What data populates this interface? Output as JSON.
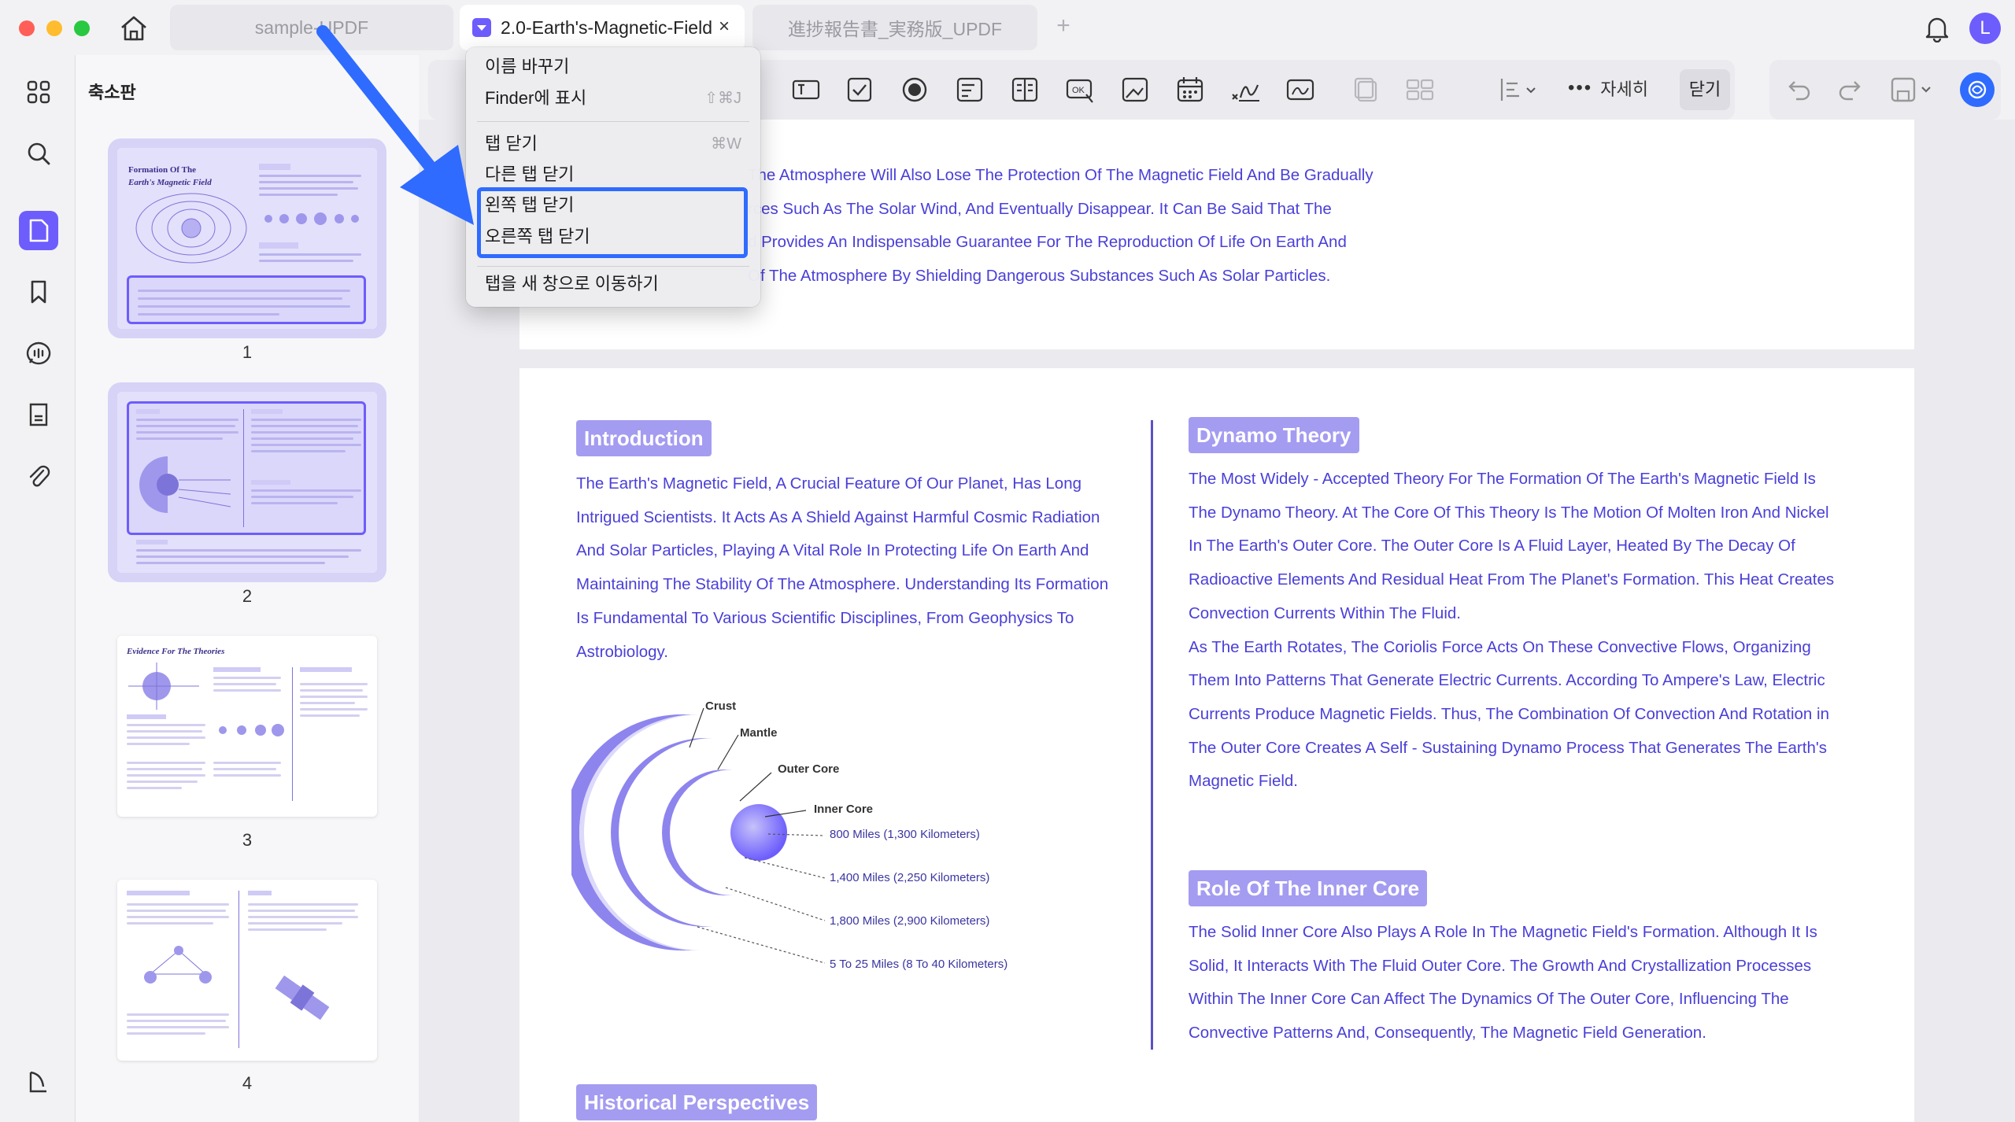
{
  "tabs": [
    {
      "label": "sample-UPDF"
    },
    {
      "label": "2.0-Earth's-Magnetic-Field"
    },
    {
      "label": "進捗報告書_実務版_UPDF"
    }
  ],
  "user": {
    "initial": "L"
  },
  "sidebar": {
    "title": "축소판"
  },
  "thumbnails": [
    {
      "number": "1",
      "title_line1": "Formation Of The",
      "title_line2": "Earth's Magnetic Field"
    },
    {
      "number": "2"
    },
    {
      "number": "3",
      "title": "Evidence For The Theories"
    },
    {
      "number": "4"
    }
  ],
  "toolbar": {
    "more_label": "자세히",
    "close_label": "닫기"
  },
  "context_menu": {
    "rename": "이름 바꾸기",
    "show_in_finder": "Finder에 표시",
    "show_in_finder_shortcut": "⇧⌘J",
    "close_tab": "탭 닫기",
    "close_tab_shortcut": "⌘W",
    "close_other_tabs": "다른 탭 닫기",
    "close_left_tabs": "왼쪽 탭 닫기",
    "close_right_tabs": "오른쪽 탭 닫기",
    "move_tab_new_window": "탭을 새 창으로 이동하기"
  },
  "page_top": {
    "lines": [
      "The Atmosphere Will Also Lose The Protection Of The Magnetic Field And Be Gradually",
      "rces Such As The Solar Wind, And Eventually Disappear. It Can Be Said That The",
      "d Provides An Indispensable Guarantee For The Reproduction Of Life On Earth And",
      "Of The Atmosphere By Shielding Dangerous Substances Such As Solar Particles."
    ]
  },
  "introduction": {
    "heading": "Introduction",
    "lines": [
      "The Earth's Magnetic Field, A Crucial Feature Of Our Planet, Has Long",
      "Intrigued Scientists. It Acts As A Shield Against Harmful Cosmic Radiation",
      "And Solar Particles, Playing A Vital Role In Protecting Life On Earth And",
      "Maintaining The Stability Of The Atmosphere. Understanding Its Formation",
      "Is Fundamental To Various Scientific Disciplines, From Geophysics To",
      "Astrobiology."
    ]
  },
  "diagram": {
    "crust": "Crust",
    "mantle": "Mantle",
    "outer_core": "Outer Core",
    "inner_core": "Inner Core",
    "m1": "800 Miles (1,300 Kilometers)",
    "m2": "1,400 Miles (2,250 Kilometers)",
    "m3": "1,800 Miles (2,900 Kilometers)",
    "m4": "5 To 25 Miles (8 To 40 Kilometers)"
  },
  "dynamo": {
    "heading": "Dynamo Theory",
    "lines": [
      "The Most Widely - Accepted Theory For The Formation Of The Earth's Magnetic Field Is",
      "The Dynamo Theory. At The Core Of This Theory Is The Motion Of Molten Iron And Nickel",
      "In The Earth's Outer Core. The Outer Core Is A Fluid Layer, Heated By The Decay Of",
      "Radioactive Elements And Residual Heat From The Planet's Formation. This Heat Creates",
      "Convection Currents Within The Fluid.",
      "As The Earth Rotates, The Coriolis Force Acts On These Convective Flows, Organizing",
      "Them Into Patterns That Generate Electric Currents. According To Ampere's Law, Electric",
      "Currents Produce Magnetic Fields. Thus, The Combination Of Convection And Rotation in",
      "The Outer Core Creates A Self - Sustaining Dynamo Process That Generates The Earth's",
      "Magnetic Field."
    ]
  },
  "inner_core_role": {
    "heading": "Role Of The Inner Core",
    "lines": [
      "The Solid Inner Core Also Plays A Role In The Magnetic Field's Formation. Although It Is",
      "Solid, It Interacts With The Fluid Outer Core. The Growth And Crystallization Processes",
      "Within The Inner Core Can Affect The Dynamics Of The Outer Core, Influencing The",
      "Convective Patterns And, Consequently, The Magnetic Field Generation."
    ]
  },
  "historical": {
    "heading": "Historical Perspectives"
  },
  "colors": {
    "accent": "#6d5dfc",
    "body_text": "#4a3fd8",
    "heading_chip": "#a49cf1",
    "highlight": "#2f6bff"
  }
}
